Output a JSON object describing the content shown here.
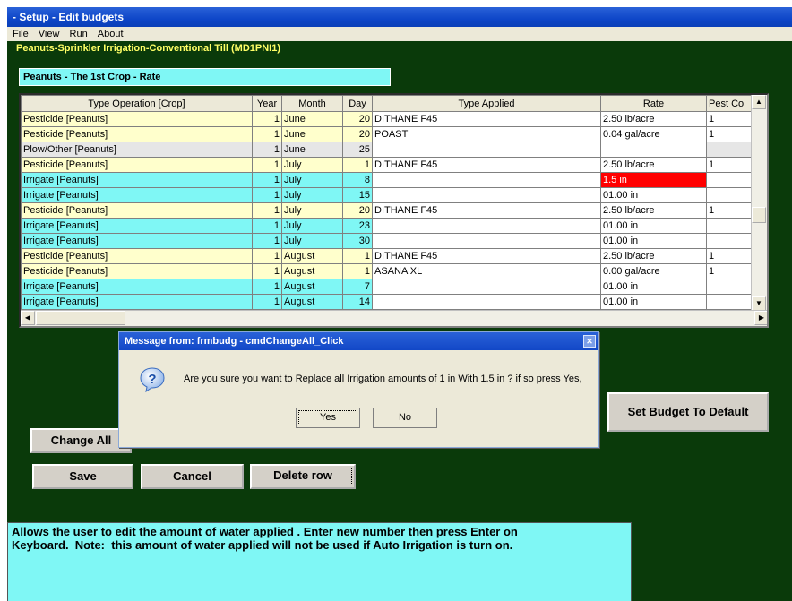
{
  "window": {
    "title": "- Setup - Edit budgets"
  },
  "menu": [
    "File",
    "View",
    "Run",
    "About"
  ],
  "budget_name": "Peanuts-Sprinkler Irrigation-Conventional Till  (MD1PNI1)",
  "crop_label": "Peanuts - The 1st Crop  - Rate",
  "grid": {
    "headers": [
      "Type Operation [Crop]",
      "Year",
      "Month",
      "Day",
      "Type Applied",
      "Rate",
      "Pest Co"
    ],
    "rows": [
      {
        "op": "Pesticide [Peanuts]",
        "year": "1",
        "month": "June",
        "day": "20",
        "applied": "DITHANE F45",
        "rate": "2.50  lb/acre",
        "pest": "1",
        "color": "yellow"
      },
      {
        "op": "Pesticide [Peanuts]",
        "year": "1",
        "month": "June",
        "day": "20",
        "applied": "POAST",
        "rate": "0.04  gal/acre",
        "pest": "1",
        "color": "yellow"
      },
      {
        "op": "Plow/Other [Peanuts]",
        "year": "1",
        "month": "June",
        "day": "25",
        "applied": "",
        "rate": "",
        "pest": "",
        "color": "gray"
      },
      {
        "op": "Pesticide [Peanuts]",
        "year": "1",
        "month": "July",
        "day": "1",
        "applied": "DITHANE F45",
        "rate": "2.50  lb/acre",
        "pest": "1",
        "color": "yellow"
      },
      {
        "op": "Irrigate [Peanuts]",
        "year": "1",
        "month": "July",
        "day": "8",
        "applied": "",
        "rate": "1.5 in",
        "pest": "",
        "color": "cyan",
        "rate_selected": true
      },
      {
        "op": "Irrigate [Peanuts]",
        "year": "1",
        "month": "July",
        "day": "15",
        "applied": "",
        "rate": "01.00 in",
        "pest": "",
        "color": "cyan"
      },
      {
        "op": "Pesticide [Peanuts]",
        "year": "1",
        "month": "July",
        "day": "20",
        "applied": "DITHANE F45",
        "rate": "2.50  lb/acre",
        "pest": "1",
        "color": "yellow"
      },
      {
        "op": "Irrigate [Peanuts]",
        "year": "1",
        "month": "July",
        "day": "23",
        "applied": "",
        "rate": "01.00 in",
        "pest": "",
        "color": "cyan"
      },
      {
        "op": "Irrigate [Peanuts]",
        "year": "1",
        "month": "July",
        "day": "30",
        "applied": "",
        "rate": "01.00 in",
        "pest": "",
        "color": "cyan"
      },
      {
        "op": "Pesticide [Peanuts]",
        "year": "1",
        "month": "August",
        "day": "1",
        "applied": "DITHANE F45",
        "rate": "2.50  lb/acre",
        "pest": "1",
        "color": "yellow"
      },
      {
        "op": "Pesticide [Peanuts]",
        "year": "1",
        "month": "August",
        "day": "1",
        "applied": "ASANA XL",
        "rate": "0.00  gal/acre",
        "pest": "1",
        "color": "yellow"
      },
      {
        "op": "Irrigate [Peanuts]",
        "year": "1",
        "month": "August",
        "day": "7",
        "applied": "",
        "rate": "01.00 in",
        "pest": "",
        "color": "cyan"
      },
      {
        "op": "Irrigate [Peanuts]",
        "year": "1",
        "month": "August",
        "day": "14",
        "applied": "",
        "rate": "01.00 in",
        "pest": "",
        "color": "cyan"
      }
    ]
  },
  "buttons": {
    "change_all": "Change All",
    "save": "Save",
    "cancel": "Cancel",
    "delete_row": "Delete row",
    "set_default": "Set Budget To Default"
  },
  "dialog": {
    "title": "Message from: frmbudg - cmdChangeAll_Click",
    "message": "Are you sure you want to Replace all Irrigation amounts of 1 in With 1.5 in ? if so press Yes,",
    "yes": "Yes",
    "no": "No",
    "icon": "question-icon"
  },
  "hint": "Allows the user to edit the amount of water applied . Enter new number then press Enter on\nKeyboard.  Note:  this amount of water applied will not be used if Auto Irrigation is turn on.",
  "colors": {
    "background": "#0a3a0a",
    "cyan_row": "#7ff7f5",
    "yellow_row": "#ffffcc",
    "selected_cell": "#ff0000",
    "title_bar": "#0e46c8"
  }
}
